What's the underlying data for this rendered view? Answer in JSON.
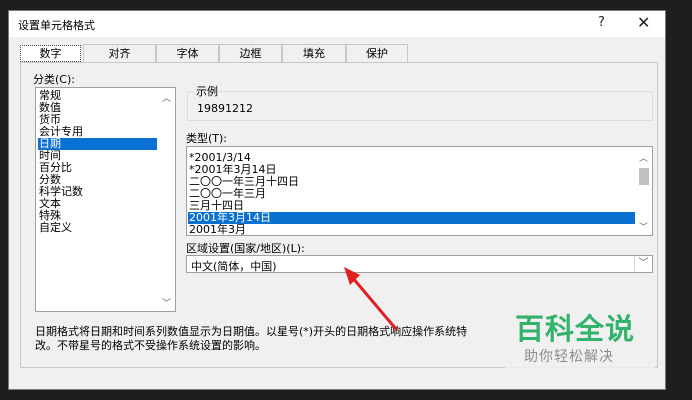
{
  "dialog": {
    "title": "设置单元格格式",
    "help_label": "?",
    "close_label": "✕"
  },
  "tabs": [
    {
      "label": "数字"
    },
    {
      "label": "对齐"
    },
    {
      "label": "字体"
    },
    {
      "label": "边框"
    },
    {
      "label": "填充"
    },
    {
      "label": "保护"
    }
  ],
  "category": {
    "label": "分类(C):",
    "items": [
      "常规",
      "数值",
      "货币",
      "会计专用",
      "日期",
      "时间",
      "百分比",
      "分数",
      "科学记数",
      "文本",
      "特殊",
      "自定义"
    ],
    "selected_index": 4
  },
  "sample": {
    "label": "示例",
    "value": "19891212"
  },
  "type": {
    "label": "类型(T):",
    "items": [
      "*2001/3/14",
      "*2001年3月14日",
      "二〇〇一年三月十四日",
      "二〇〇一年三月",
      "三月十四日",
      "2001年3月14日",
      "2001年3月"
    ],
    "selected_index": 5
  },
  "locale": {
    "label": "区域设置(国家/地区)(L):",
    "value": "中文(简体，中国)"
  },
  "description": {
    "line1": "日期格式将日期和时间系列数值显示为日期值。以星号(*)开头的日期格式响应操作系统特",
    "line2": "改。不带星号的格式不受操作系统设置的影响。"
  },
  "watermark": {
    "brand": "百科全说",
    "tagline": "助你轻松解决"
  },
  "colors": {
    "selection": "#0b71d0",
    "arrow": "#e02020",
    "watermark_green": "#33b26b"
  }
}
